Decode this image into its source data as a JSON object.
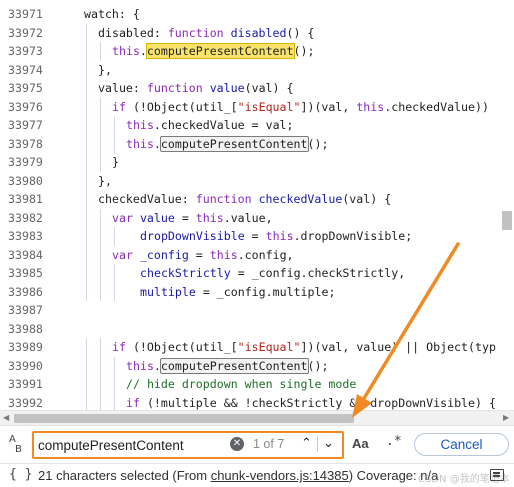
{
  "editor": {
    "lines": [
      {
        "n": "33971",
        "indent": 0,
        "segs": [
          {
            "t": "watch: {"
          }
        ]
      },
      {
        "n": "33972",
        "indent": 1,
        "segs": [
          {
            "t": "disabled: "
          },
          {
            "t": "function",
            "c": "kw"
          },
          {
            "t": " "
          },
          {
            "t": "disabled",
            "c": "fn"
          },
          {
            "t": "() {"
          }
        ]
      },
      {
        "n": "33973",
        "indent": 2,
        "segs": [
          {
            "t": "this",
            "c": "kw"
          },
          {
            "t": "."
          },
          {
            "t": "computePresentContent",
            "c": "hl-cur"
          },
          {
            "t": "();"
          }
        ]
      },
      {
        "n": "33974",
        "indent": 1,
        "segs": [
          {
            "t": "},"
          }
        ]
      },
      {
        "n": "33975",
        "indent": 1,
        "segs": [
          {
            "t": "value: "
          },
          {
            "t": "function",
            "c": "kw"
          },
          {
            "t": " "
          },
          {
            "t": "value",
            "c": "fn"
          },
          {
            "t": "(val) {"
          }
        ]
      },
      {
        "n": "33976",
        "indent": 2,
        "segs": [
          {
            "t": "if",
            "c": "kw"
          },
          {
            "t": " (!Object(util_["
          },
          {
            "t": "\"isEqual\"",
            "c": "str"
          },
          {
            "t": "])(val, "
          },
          {
            "t": "this",
            "c": "kw"
          },
          {
            "t": ".checkedValue))"
          }
        ]
      },
      {
        "n": "33977",
        "indent": 3,
        "segs": [
          {
            "t": "this",
            "c": "kw"
          },
          {
            "t": ".checkedValue = val;"
          }
        ]
      },
      {
        "n": "33978",
        "indent": 3,
        "segs": [
          {
            "t": "this",
            "c": "kw"
          },
          {
            "t": "."
          },
          {
            "t": "computePresentContent",
            "c": "hl-oth"
          },
          {
            "t": "();"
          }
        ]
      },
      {
        "n": "33979",
        "indent": 2,
        "segs": [
          {
            "t": "}"
          }
        ]
      },
      {
        "n": "33980",
        "indent": 1,
        "segs": [
          {
            "t": "},"
          }
        ]
      },
      {
        "n": "33981",
        "indent": 1,
        "segs": [
          {
            "t": "checkedValue: "
          },
          {
            "t": "function",
            "c": "kw"
          },
          {
            "t": " "
          },
          {
            "t": "checkedValue",
            "c": "fn"
          },
          {
            "t": "(val) {"
          }
        ]
      },
      {
        "n": "33982",
        "indent": 2,
        "segs": [
          {
            "t": "var",
            "c": "kw"
          },
          {
            "t": " "
          },
          {
            "t": "value",
            "c": "vid"
          },
          {
            "t": " = "
          },
          {
            "t": "this",
            "c": "kw"
          },
          {
            "t": ".value,"
          }
        ]
      },
      {
        "n": "33983",
        "indent": 4,
        "segs": [
          {
            "t": "dropDownVisible",
            "c": "vid"
          },
          {
            "t": " = "
          },
          {
            "t": "this",
            "c": "kw"
          },
          {
            "t": ".dropDownVisible;"
          }
        ]
      },
      {
        "n": "33984",
        "indent": 2,
        "segs": [
          {
            "t": "var",
            "c": "kw"
          },
          {
            "t": " "
          },
          {
            "t": "_config",
            "c": "vid"
          },
          {
            "t": " = "
          },
          {
            "t": "this",
            "c": "kw"
          },
          {
            "t": ".config,"
          }
        ]
      },
      {
        "n": "33985",
        "indent": 4,
        "segs": [
          {
            "t": "checkStrictly",
            "c": "vid"
          },
          {
            "t": " = _config.checkStrictly,"
          }
        ]
      },
      {
        "n": "33986",
        "indent": 4,
        "segs": [
          {
            "t": "multiple",
            "c": "vid"
          },
          {
            "t": " = _config.multiple;"
          }
        ]
      },
      {
        "n": "33987",
        "indent": 0,
        "segs": []
      },
      {
        "n": "33988",
        "indent": 0,
        "segs": []
      },
      {
        "n": "33989",
        "indent": 2,
        "segs": [
          {
            "t": "if",
            "c": "kw"
          },
          {
            "t": " (!Object(util_["
          },
          {
            "t": "\"isEqual\"",
            "c": "str"
          },
          {
            "t": "])(val, value) || Object(typ"
          }
        ]
      },
      {
        "n": "33990",
        "indent": 3,
        "segs": [
          {
            "t": "this",
            "c": "kw"
          },
          {
            "t": "."
          },
          {
            "t": "computePresentContent",
            "c": "hl-oth"
          },
          {
            "t": "();"
          }
        ]
      },
      {
        "n": "33991",
        "indent": 3,
        "segs": [
          {
            "t": "// hide dropdown when single mode",
            "c": "cm"
          }
        ]
      },
      {
        "n": "33992",
        "indent": 3,
        "segs": [
          {
            "t": "if",
            "c": "kw"
          },
          {
            "t": " (!multiple && !checkStrictly && dropDownVisible) {"
          }
        ]
      }
    ]
  },
  "search": {
    "query": "computePresentContent",
    "match_count": "1 of 7",
    "clear_icon": "clear-circle-icon",
    "prev_icon": "chevron-up-icon",
    "next_icon": "chevron-down-icon",
    "case_label": "Aa",
    "regex_label": ".*",
    "cancel_label": "Cancel",
    "ab_label": "A",
    "ab_sub": "B"
  },
  "status": {
    "braces": "{ }",
    "before_link": "21 characters selected  (From ",
    "link": "chunk-vendors.js:14385",
    "after_link": ")  Coverage: n/a",
    "watermark": "CSDN @我的笔记本"
  },
  "colors": {
    "accent": "#f08a24",
    "link": "#1a58c5",
    "current_match": "#f7e36b"
  }
}
